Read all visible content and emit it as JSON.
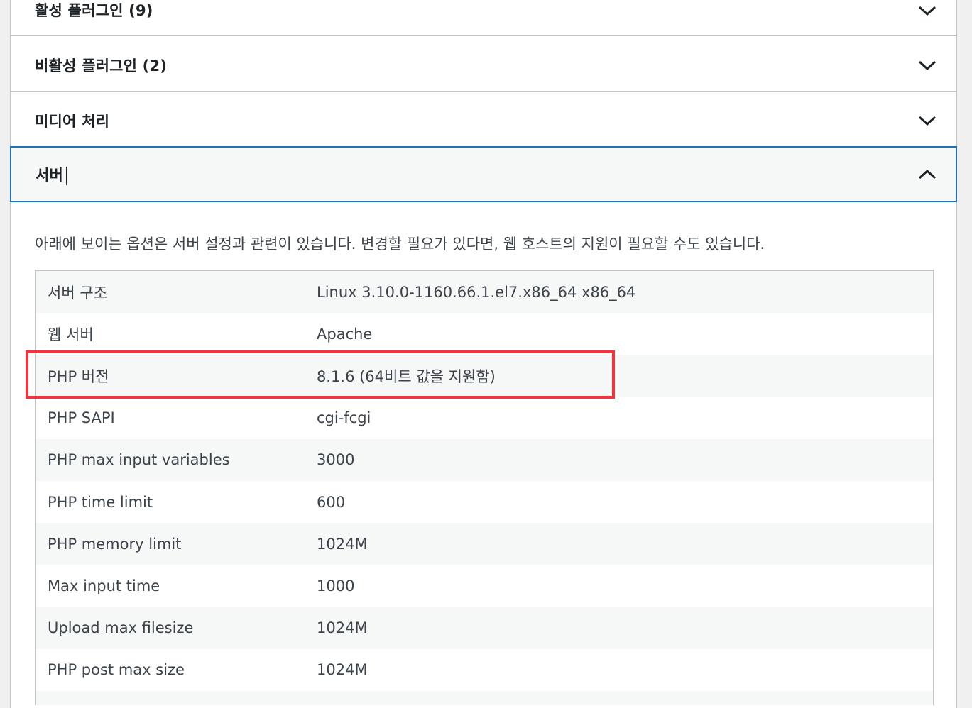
{
  "sections": [
    {
      "label": "활성 플러그인 (9)",
      "expanded": false
    },
    {
      "label": "비활성 플러그인 (2)",
      "expanded": false
    },
    {
      "label": "미디어 처리",
      "expanded": false
    },
    {
      "label": "서버",
      "expanded": true
    }
  ],
  "server": {
    "description": "아래에 보이는 옵션은 서버 설정과 관련이 있습니다. 변경할 필요가 있다면, 웹 호스트의 지원이 필요할 수도 있습니다.",
    "rows": [
      {
        "key": "서버 구조",
        "value": "Linux 3.10.0-1160.66.1.el7.x86_64 x86_64"
      },
      {
        "key": "웹 서버",
        "value": "Apache"
      },
      {
        "key": "PHP 버전",
        "value": "8.1.6 (64비트 값을 지원함)"
      },
      {
        "key": "PHP SAPI",
        "value": "cgi-fcgi"
      },
      {
        "key": "PHP max input variables",
        "value": "3000"
      },
      {
        "key": "PHP time limit",
        "value": "600"
      },
      {
        "key": "PHP memory limit",
        "value": "1024M"
      },
      {
        "key": "Max input time",
        "value": "1000"
      },
      {
        "key": "Upload max filesize",
        "value": "1024M"
      },
      {
        "key": "PHP post max size",
        "value": "1024M"
      }
    ]
  },
  "colors": {
    "accent": "#2271b1",
    "highlight": "#f0353e",
    "border": "#c3c4c7"
  },
  "icons": {
    "collapsed": "chevron-down-icon",
    "expanded": "chevron-up-icon"
  }
}
